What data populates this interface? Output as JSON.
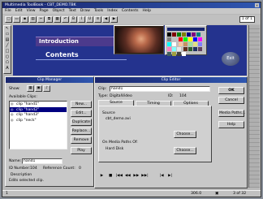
{
  "app": {
    "title": "Multimedia ToolBook - CBT_DEMO.TBK",
    "menu": [
      "File",
      "Edit",
      "View",
      "Page",
      "Object",
      "Text",
      "Draw",
      "Tools",
      "Index",
      "Contents",
      "Help"
    ],
    "page_indicator": "1 of 1",
    "colors": {
      "titlebar": "#19266e",
      "book_bg": "#2a3a9a",
      "dialog": "#c8c8c8"
    }
  },
  "book": {
    "heading": "Introduction",
    "subheading": "Contents",
    "exit_label": "Exit"
  },
  "clip_manager": {
    "title": "Clip Manager",
    "show_label": "Show:",
    "available_label": "Available Clips:",
    "clips": [
      {
        "icon": "cd-icon",
        "name": "clip \"hand1\""
      },
      {
        "icon": "cd-icon",
        "name": "clip \"hand2\""
      },
      {
        "icon": "cd-icon",
        "name": "clip \"hand3\""
      },
      {
        "icon": "cd-icon",
        "name": "clip \"neck\""
      }
    ],
    "buttons": [
      "New...",
      "Edit...",
      "Duplicate",
      "Replace...",
      "Remove",
      "Play"
    ],
    "name_label": "Name:",
    "name_value": "hand1",
    "id_label": "ID Number:",
    "id_value": "104",
    "ref_label": "Reference Count:",
    "ref_value": "0",
    "description_label": "Description",
    "description_value": "Edits selected clip."
  },
  "clip_editor": {
    "title": "Clip Editor",
    "clip_label": "Clip:",
    "clip_value": "hand1",
    "type_label": "Type:",
    "type_value": "DigitalVideo",
    "id_label": "ID:",
    "id_value": "104",
    "tabs": [
      "Source",
      "Timing",
      "Options"
    ],
    "source_label": "Source",
    "source_value": "cbt_demo.avi",
    "choose_label": "Choose...",
    "media_paths_label": "On Media Paths Of:",
    "media_paths_value": "Hard Disk",
    "choose2_label": "Choose...",
    "buttons": [
      "OK",
      "Cancel",
      "Media Paths...",
      "Help"
    ],
    "transport": [
      "▶",
      "■",
      "|◀◀",
      "◀◀",
      "▶▶",
      "▶▶|",
      "|◀",
      "▶|"
    ]
  },
  "status": {
    "left": "1",
    "mid": "306.0",
    "page": "3 of 32"
  }
}
